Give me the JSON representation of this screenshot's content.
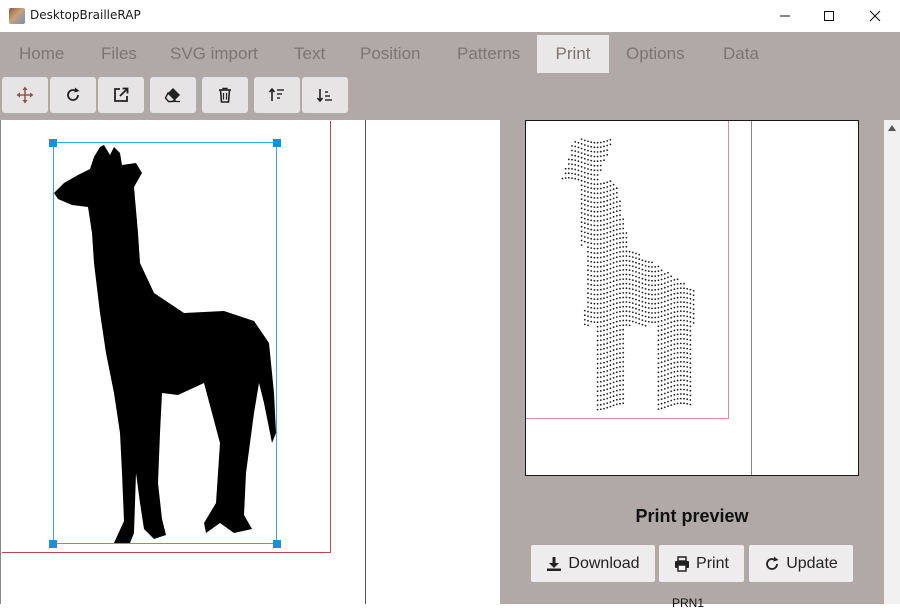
{
  "window": {
    "title": "DesktopBrailleRAP"
  },
  "menu": {
    "tabs": [
      {
        "label": "Home"
      },
      {
        "label": "Files"
      },
      {
        "label": "SVG import"
      },
      {
        "label": "Text"
      },
      {
        "label": "Position"
      },
      {
        "label": "Patterns"
      },
      {
        "label": "Print",
        "active": true
      },
      {
        "label": "Options"
      },
      {
        "label": "Data"
      }
    ]
  },
  "toolbar": {
    "buttons": [
      "move-icon",
      "rotate-icon",
      "open-external-icon",
      "eraser-icon",
      "trash-icon",
      "sort-ascending-icon",
      "sort-descending-icon"
    ]
  },
  "preview": {
    "title": "Print preview",
    "download_label": "Download",
    "print_label": "Print",
    "update_label": "Update",
    "cutoff_text": "PRN1"
  },
  "colors": {
    "chrome": "#b1a9a8",
    "active_tab": "#e9e7e7",
    "selection": "#3aa7d8",
    "page_border": "#b84a4a",
    "preview_margin": "#e38a9a"
  }
}
